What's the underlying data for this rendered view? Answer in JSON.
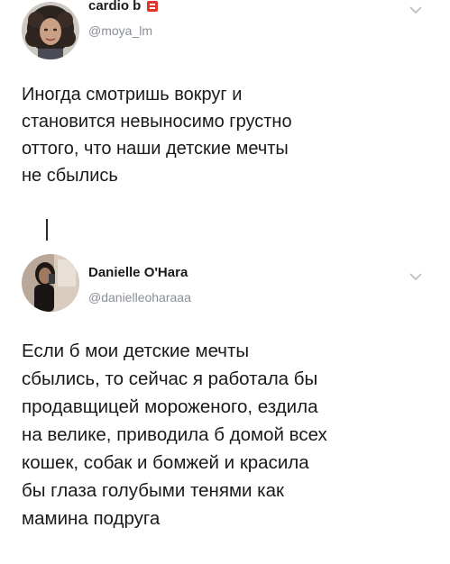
{
  "tweets": [
    {
      "display_name": "cardio b",
      "handle": "@moya_lm",
      "text": "Иногда смотришь вокруг и\nстановится невыносимо грустно\nоттого, что наши детские мечты\nне сбылись",
      "avatar_icon": "profile-photo-curly-hair",
      "badge_icon": "red-emoji-badge-icon",
      "menu_icon": "chevron-down-icon"
    },
    {
      "display_name": "Danielle O'Hara",
      "handle": "@danielleoharaaa",
      "text": "Если б мои детские мечты\nсбылись, то сейчас я работала бы\nпродавщицей мороженого, ездила\nна велике, приводила б домой всех\nкошек, собак и бомжей и красила\nбы глаза голубыми тенями как\nмамина подруга",
      "avatar_icon": "profile-photo-mirror-selfie",
      "menu_icon": "chevron-down-icon"
    }
  ],
  "colors": {
    "text": "#1a1a1a",
    "handle": "#8a8f95",
    "chevron": "#b8bcc2",
    "badge": "#e0352b"
  }
}
